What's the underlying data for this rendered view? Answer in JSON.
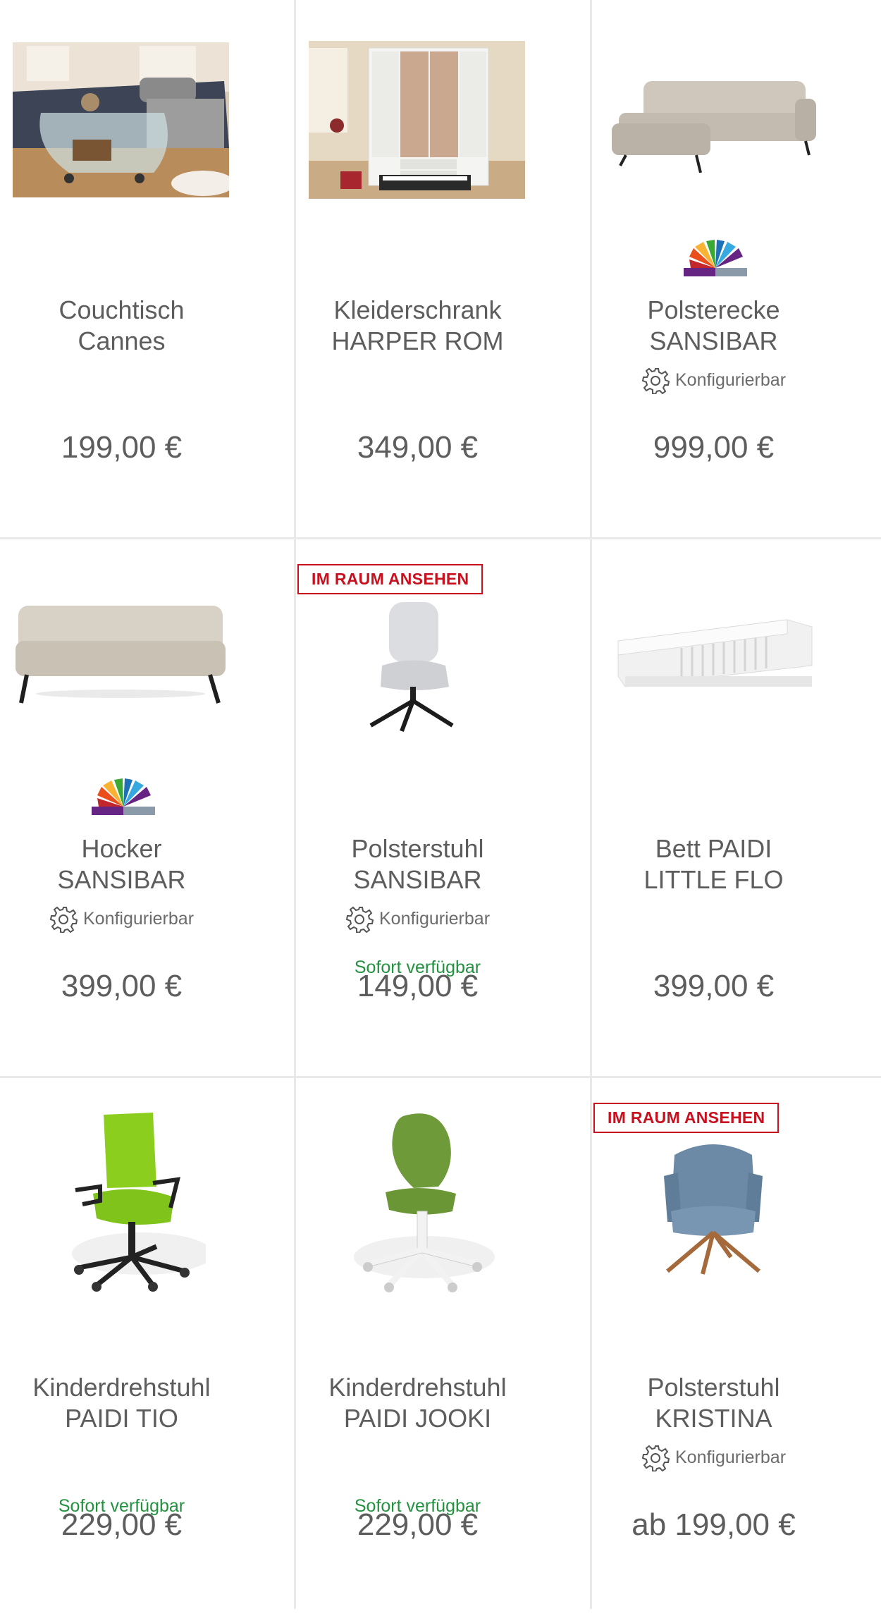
{
  "products": [
    {
      "title_1": "Couchtisch",
      "title_2": "Cannes",
      "price": "199,00 €",
      "configurable": "",
      "availability": "",
      "badge": "",
      "image_icon": "glass-coffee-table-photo"
    },
    {
      "title_1": "Kleiderschrank",
      "title_2": "HARPER ROM",
      "price": "349,00 €",
      "configurable": "",
      "availability": "",
      "badge": "",
      "image_icon": "white-wardrobe-photo"
    },
    {
      "title_1": "Polsterecke",
      "title_2": "SANSIBAR",
      "price": "999,00 €",
      "configurable": "Konfigurierbar",
      "availability": "",
      "badge": "",
      "image_icon": "corner-sofa-photo"
    },
    {
      "title_1": "Hocker",
      "title_2": "SANSIBAR",
      "price": "399,00 €",
      "configurable": "Konfigurierbar",
      "availability": "",
      "badge": "",
      "image_icon": "ottoman-photo"
    },
    {
      "title_1": "Polsterstuhl",
      "title_2": "SANSIBAR",
      "price": "149,00 €",
      "configurable": "Konfigurierbar",
      "availability": "Sofort verfügbar",
      "badge": "IM RAUM ANSEHEN",
      "image_icon": "grey-swivel-chair-photo"
    },
    {
      "title_1": "Bett PAIDI",
      "title_2": "LITTLE FLO",
      "price": "399,00 €",
      "configurable": "",
      "availability": "",
      "badge": "",
      "image_icon": "white-kids-bed-photo"
    },
    {
      "title_1": "Kinderdrehstuhl",
      "title_2": "PAIDI TIO",
      "price": "229,00 €",
      "configurable": "",
      "availability": "Sofort verfügbar",
      "badge": "",
      "image_icon": "green-office-chair-photo"
    },
    {
      "title_1": "Kinderdrehstuhl",
      "title_2": "PAIDI JOOKI",
      "price": "229,00 €",
      "configurable": "",
      "availability": "Sofort verfügbar",
      "badge": "",
      "image_icon": "green-kids-chair-photo"
    },
    {
      "title_1": "Polsterstuhl",
      "title_2": "KRISTINA",
      "price": "ab 199,00 €",
      "configurable": "Konfigurierbar",
      "availability": "",
      "badge": "IM RAUM ANSEHEN",
      "image_icon": "blue-armchair-photo"
    }
  ],
  "colors": {
    "price_text": "#5d5d5d",
    "availability_green": "#23913f",
    "badge_red": "#c8101e",
    "grid_line": "#e9e9e9"
  }
}
